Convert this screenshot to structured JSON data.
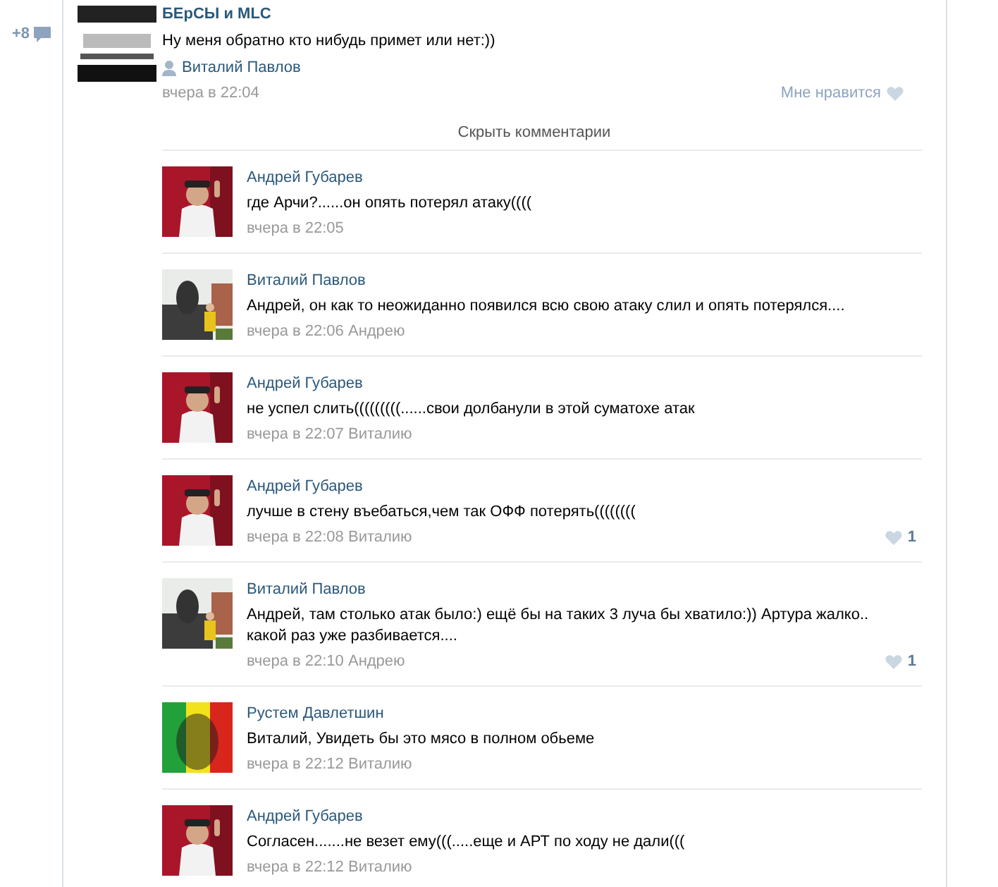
{
  "gutter": {
    "count": "+8"
  },
  "post": {
    "author": "БЕрСЫ и MLC",
    "text": "Ну меня обратно кто нибудь примет или нет:))",
    "signer": "Виталий Павлов",
    "time": "вчера в 22:04",
    "like_label": "Мне нравится"
  },
  "hide_comments": "Скрыть комментарии",
  "comments": [
    {
      "author": "Андрей Губарев",
      "text": "где Арчи?......он опять потерял атаку((((",
      "time": "вчера в 22:05"
    },
    {
      "author": "Виталий Павлов",
      "text": "Андрей, он как то неожиданно появился всю свою атаку слил и опять потерялся....",
      "time": "вчера в 22:06",
      "reply_to": "Андрею"
    },
    {
      "author": "Андрей Губарев",
      "text": "не успел слить(((((((((......свои долбанули в этой суматохе атак",
      "time": "вчера в 22:07",
      "reply_to": "Виталию"
    },
    {
      "author": "Андрей Губарев",
      "text": "лучше в стену въебаться,чем так ОФФ потерять((((((((",
      "time": "вчера в 22:08",
      "reply_to": "Виталию",
      "likes": "1"
    },
    {
      "author": "Виталий Павлов",
      "text": "Андрей, там столько атак было:) ещё бы на таких 3 луча бы хватило:)) Артура жалко.. какой раз уже разбивается....",
      "time": "вчера в 22:10",
      "reply_to": "Андрею",
      "likes": "1"
    },
    {
      "author": "Рустем Давлетшин",
      "text": "Виталий, Увидеть бы это мясо в полном обьеме",
      "time": "вчера в 22:12",
      "reply_to": "Виталию"
    },
    {
      "author": "Андрей Губарев",
      "text": "Согласен.......не везет ему(((.....еще и АРТ по ходу не дали(((",
      "time": "вчера в 22:12",
      "reply_to": "Виталию"
    }
  ]
}
